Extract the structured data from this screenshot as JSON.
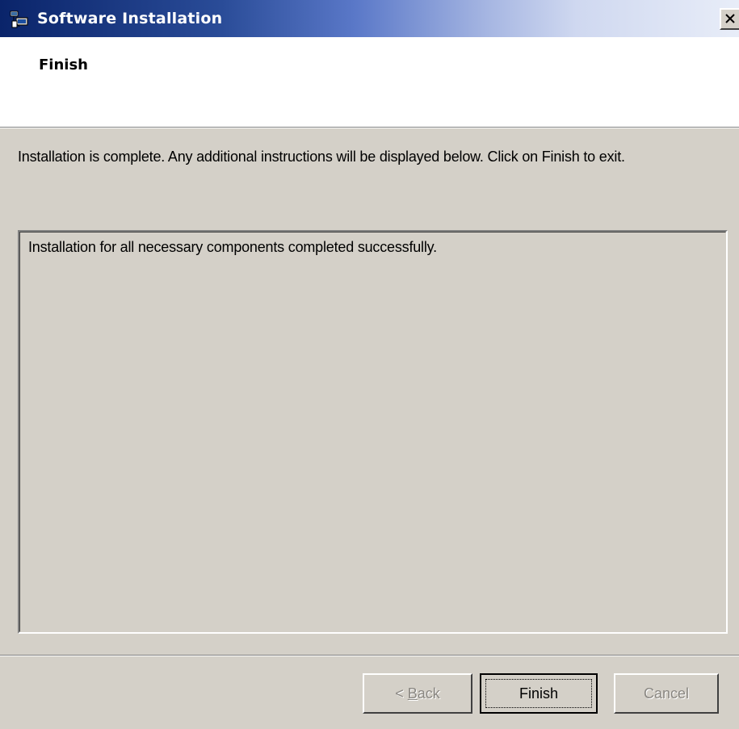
{
  "window": {
    "title": "Software Installation",
    "icon": "installer-icon",
    "close_glyph": "×"
  },
  "header": {
    "title": "Finish"
  },
  "body": {
    "instructions": "Installation is complete.  Any additional instructions will be displayed below.  Click on Finish to exit.",
    "log_text": "Installation for all necessary components completed successfully."
  },
  "buttons": {
    "back": {
      "prefix": "< ",
      "mnemonic": "B",
      "rest": "ack",
      "enabled": false
    },
    "finish": {
      "label": "Finish",
      "enabled": true,
      "default": true
    },
    "cancel": {
      "label": "Cancel",
      "enabled": false
    }
  },
  "colors": {
    "titlebar_start": "#0a246a",
    "titlebar_end": "#e8edf8",
    "dialog_face": "#d4d0c8",
    "header_bg": "#ffffff",
    "disabled_text": "#8a8782"
  }
}
